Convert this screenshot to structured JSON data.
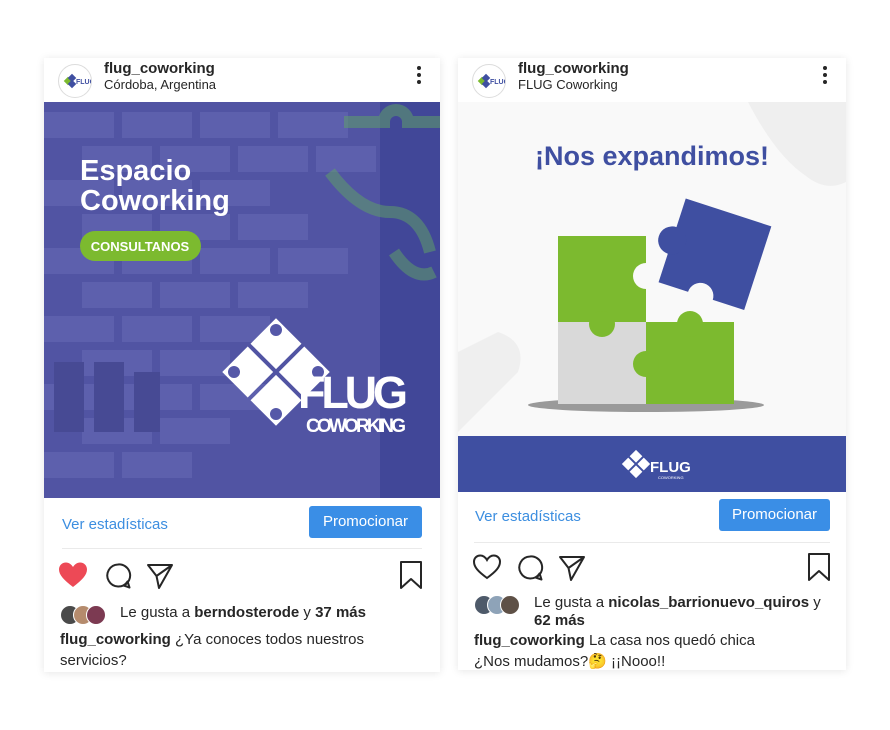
{
  "colors": {
    "brand_blue": "#3f4fa1",
    "brand_green": "#7cba2f",
    "puzzle_gray": "#d9d9d9",
    "link_blue": "#3c8ee0",
    "like_red": "#ed4956"
  },
  "posts": [
    {
      "username": "flug_coworking",
      "location": "Córdoba, Argentina",
      "image": {
        "headline_line1": "Espacio",
        "headline_line2": "Coworking",
        "cta": "CONSULTANOS",
        "logo_word": "FLUG",
        "logo_sub": "COWORKING"
      },
      "stats_link": "Ver estadísticas",
      "promote_label": "Promocionar",
      "liked": true,
      "likes_prefix": "Le gusta a",
      "likes_user": "berndosterode",
      "likes_joiner": "y",
      "likes_more": "37 más",
      "caption_user": "flug_coworking",
      "caption_text": "¿Ya conoces todos nuestros servicios?"
    },
    {
      "username": "flug_coworking",
      "location": "FLUG Coworking",
      "image": {
        "headline": "¡Nos expandimos!",
        "logo_word": "FLUG",
        "logo_sub": "COWORKING"
      },
      "stats_link": "Ver estadísticas",
      "promote_label": "Promocionar",
      "liked": false,
      "likes_prefix": "Le gusta a",
      "likes_user": "nicolas_barrionuevo_quiros",
      "likes_joiner": "y",
      "likes_more": "62 más",
      "caption_user": "flug_coworking",
      "caption_text": "La casa nos quedó chica",
      "caption_line2": "¿Nos mudamos?🤔 ¡¡Nooo!!"
    }
  ]
}
